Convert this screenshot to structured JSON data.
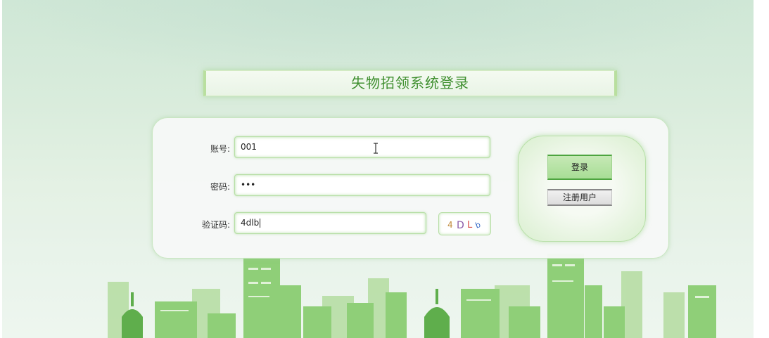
{
  "title": "失物招领系统登录",
  "form": {
    "account_label": "账号:",
    "account_value": "001",
    "password_label": "密码:",
    "password_value": "•••",
    "captcha_label": "验证码:",
    "captcha_value": "4dlb"
  },
  "captcha": {
    "chars": [
      "4",
      "D",
      "L",
      "b"
    ],
    "colors": [
      "#c08a3a",
      "#8a5aa8",
      "#d8504a",
      "#3a6ec8"
    ]
  },
  "buttons": {
    "login_label": "登录",
    "register_label": "注册用户"
  },
  "colors": {
    "accent": "#3f8f2f",
    "field_glow": "#b6dea4",
    "skyline": "#8fcf78"
  }
}
